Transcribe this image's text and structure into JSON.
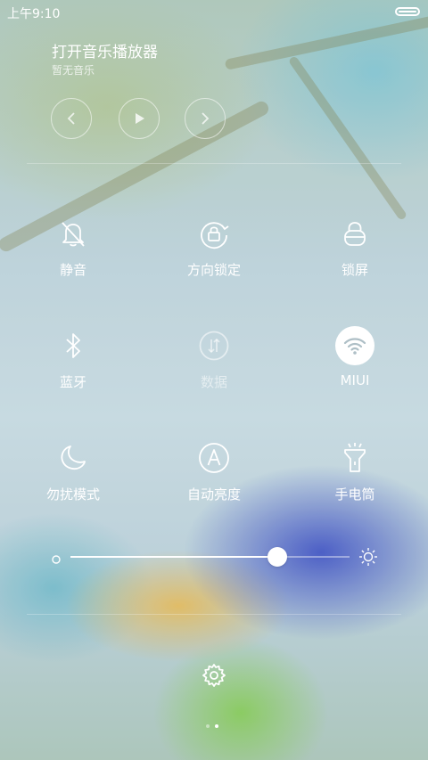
{
  "status_bar": {
    "time": "上午9:10",
    "battery_level": 1.0
  },
  "music": {
    "title": "打开音乐播放器",
    "subtitle": "暂无音乐",
    "controls": [
      "previous-icon",
      "play-icon",
      "next-icon"
    ]
  },
  "toggles": [
    {
      "label": "静音",
      "icon": "mute-bell-icon",
      "active": false
    },
    {
      "label": "方向锁定",
      "icon": "rotation-lock-icon",
      "active": false
    },
    {
      "label": "锁屏",
      "icon": "lock-icon",
      "active": false
    },
    {
      "label": "蓝牙",
      "icon": "bluetooth-icon",
      "active": false
    },
    {
      "label": "数据",
      "icon": "mobile-data-icon",
      "active": false,
      "disabled": true
    },
    {
      "label": "MIUI",
      "icon": "wifi-icon",
      "active": true
    },
    {
      "label": "勿扰模式",
      "icon": "moon-icon",
      "active": false
    },
    {
      "label": "自动亮度",
      "icon": "auto-brightness-icon",
      "active": false
    },
    {
      "label": "手电筒",
      "icon": "flashlight-icon",
      "active": false
    }
  ],
  "brightness": {
    "level": 0.74
  },
  "pager": {
    "total": 2,
    "current": 2
  }
}
